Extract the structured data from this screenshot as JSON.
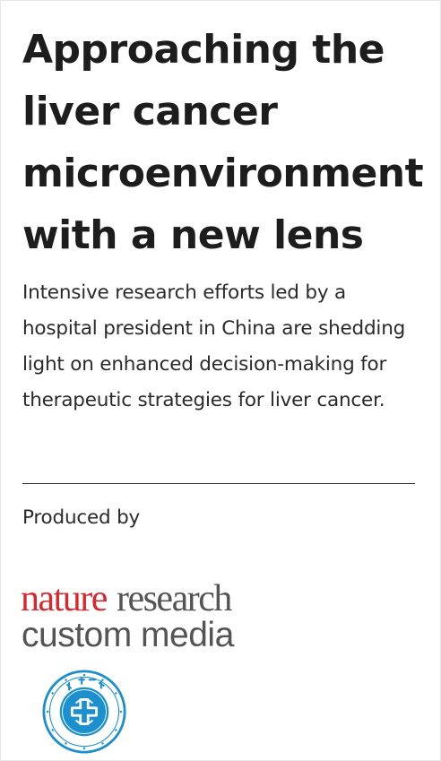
{
  "article": {
    "headline": "Approaching the liver cancer microenvironment with a new lens",
    "standfirst": "Intensive research efforts led by a hospital president in China are shedding light on enhanced decision-making for therapeutic strategies for liver cancer.",
    "produced_by": "Produced by"
  },
  "logos": {
    "producer": {
      "word_nature": "nature",
      "word_research": "research",
      "line2": "custom media",
      "color_nature": "#d7282f",
      "color_text": "#545454"
    },
    "hospital_seal": {
      "icon": "hospital-seal-icon",
      "color": "#1c8fcf"
    }
  }
}
